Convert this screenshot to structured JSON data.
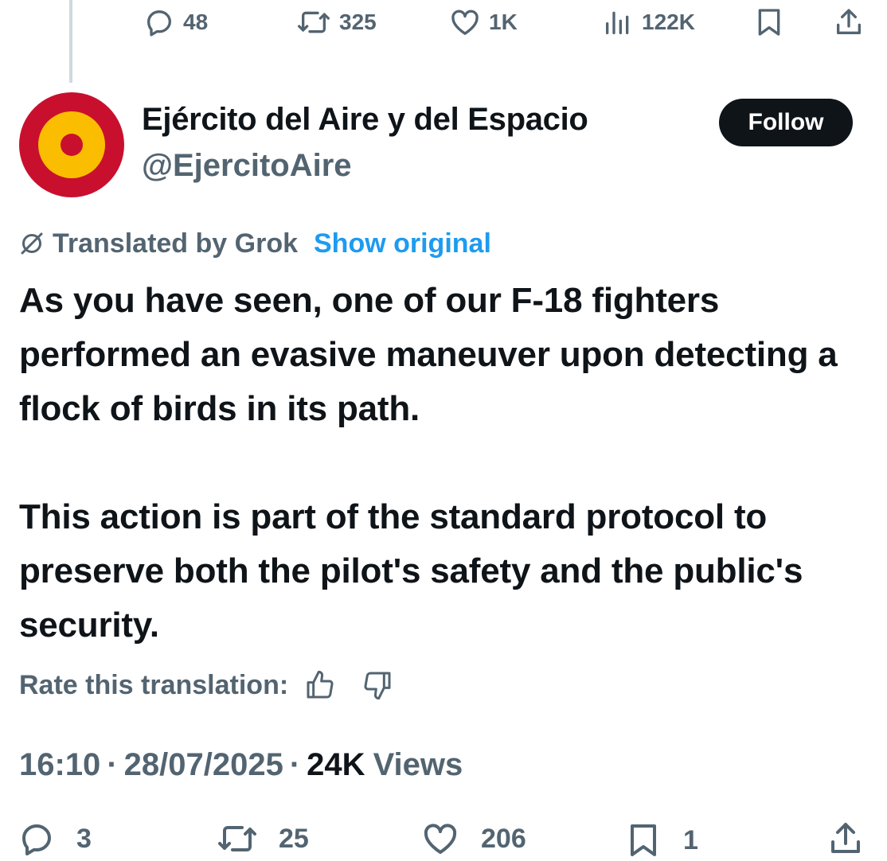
{
  "parent_actions": {
    "replies": "48",
    "reposts": "325",
    "likes": "1K",
    "views": "122K"
  },
  "author": {
    "display_name": "Ejército del Aire y del Espacio",
    "handle": "@EjercitoAire",
    "avatar_colors": {
      "outer": "#c8102e",
      "middle": "#fabd00",
      "inner": "#c8102e"
    }
  },
  "follow_label": "Follow",
  "translation": {
    "translated_by": "Translated by Grok",
    "show_original": "Show original"
  },
  "tweet": {
    "paragraph_1": "As you have seen, one of our F-18 fighters performed an evasive maneuver upon detecting a flock of birds in its path.",
    "paragraph_2": "This action is part of the standard protocol to preserve both the pilot's safety and the public's security."
  },
  "rate": {
    "label": "Rate this translation:"
  },
  "meta": {
    "time": "16:10",
    "separator": "·",
    "date": "28/07/2025",
    "views_count": "24K",
    "views_label": "Views"
  },
  "actions": {
    "replies": "3",
    "reposts": "25",
    "likes": "206",
    "bookmarks": "1"
  },
  "colors": {
    "text_primary": "#0f1419",
    "text_secondary": "#536471",
    "link": "#1d9bf0",
    "follow_bg": "#0f1419",
    "thread_line": "#cfd9de"
  }
}
